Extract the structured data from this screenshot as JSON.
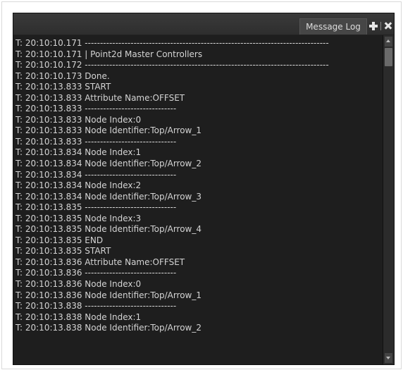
{
  "panel": {
    "tab_label": "Message Log",
    "icons": [
      "plus-icon",
      "close-icon"
    ],
    "colors": {
      "background": "#1e1e1e",
      "text": "#d4d4d4",
      "header": "#333333"
    }
  },
  "log_lines": [
    "T: 20:10:10.171 --------------------------------------------------------------------------------",
    "T: 20:10:10.171 | Point2d Master Controllers",
    "T: 20:10:10.172 --------------------------------------------------------------------------------",
    "T: 20:10:10.173 Done.",
    "T: 20:10:13.833 START",
    "T: 20:10:13.833 Attribute Name:OFFSET",
    "T: 20:10:13.833 ------------------------------",
    "T: 20:10:13.833 Node Index:0",
    "T: 20:10:13.833 Node Identifier:Top/Arrow_1",
    "T: 20:10:13.833 ------------------------------",
    "T: 20:10:13.834 Node Index:1",
    "T: 20:10:13.834 Node Identifier:Top/Arrow_2",
    "T: 20:10:13.834 ------------------------------",
    "T: 20:10:13.834 Node Index:2",
    "T: 20:10:13.834 Node Identifier:Top/Arrow_3",
    "T: 20:10:13.835 ------------------------------",
    "T: 20:10:13.835 Node Index:3",
    "T: 20:10:13.835 Node Identifier:Top/Arrow_4",
    "T: 20:10:13.835 END",
    "T: 20:10:13.835 START",
    "T: 20:10:13.836 Attribute Name:OFFSET",
    "T: 20:10:13.836 ------------------------------",
    "T: 20:10:13.836 Node Index:0",
    "T: 20:10:13.836 Node Identifier:Top/Arrow_1",
    "T: 20:10:13.838 ------------------------------",
    "T: 20:10:13.838 Node Index:1",
    "T: 20:10:13.838 Node Identifier:Top/Arrow_2"
  ]
}
